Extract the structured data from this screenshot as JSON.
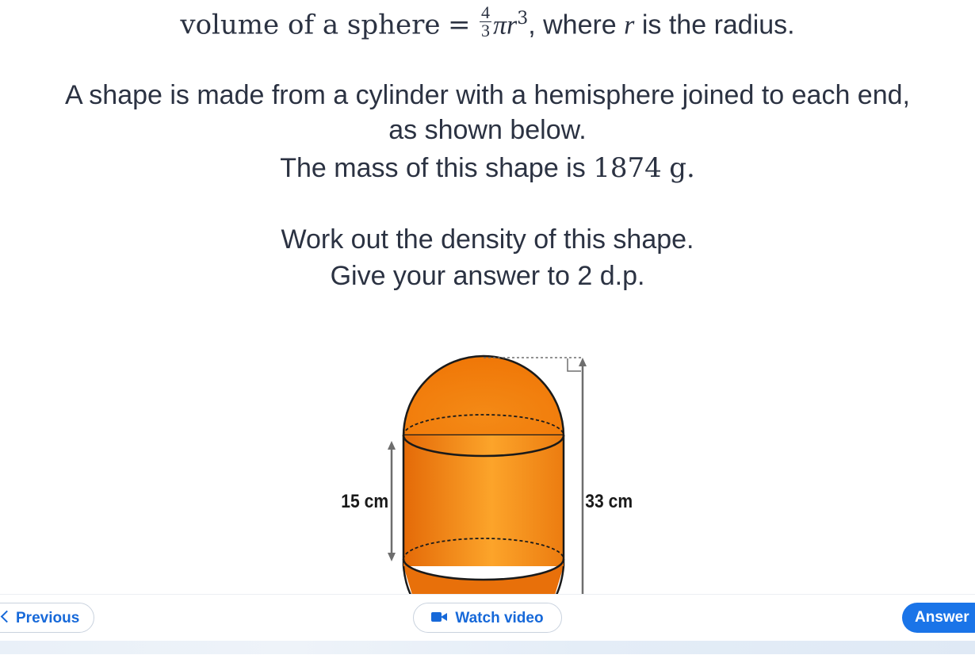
{
  "formula": {
    "lhs": "volume of a sphere",
    "equals": "=",
    "frac_num": "4",
    "frac_den": "3",
    "pi": "π",
    "var": "r",
    "exp": "3",
    "suffix": ", where",
    "r_symbol": "r",
    "tail": "is the radius."
  },
  "question": {
    "line1": "A shape is made from a cylinder with a hemisphere joined to each end,",
    "line2": "as shown below.",
    "mass_prefix": "The mass of this shape is",
    "mass_value": "1874",
    "mass_unit": "g.",
    "line4": "Work out the density of this shape.",
    "line5": "Give your answer to 2 d.p."
  },
  "diagram": {
    "label_cylinder_height": "15 cm",
    "label_total_height": "33 cm",
    "colors": {
      "orange": "#f7921e",
      "orange_dark": "#e8700a",
      "outline": "#1a1a1a",
      "arrow": "#6e6e6e"
    }
  },
  "footer": {
    "previous_label": "Previous",
    "video_label": "Watch video",
    "answer_label": "Answer"
  }
}
